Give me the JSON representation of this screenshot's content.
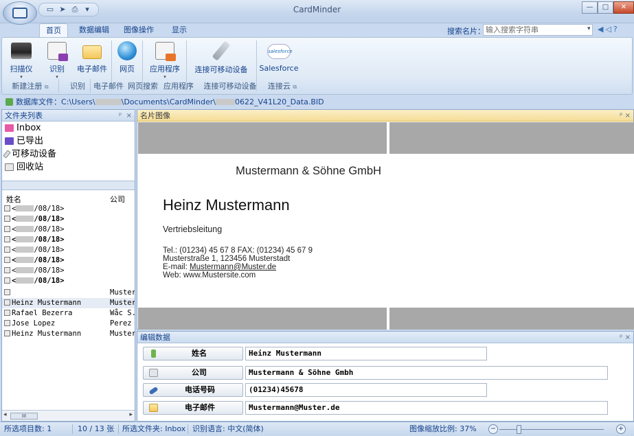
{
  "window": {
    "title": "CardMinder"
  },
  "quick_access": {
    "icons": [
      "scanner-icon",
      "pointer-icon",
      "print-icon",
      "dropdown-icon"
    ]
  },
  "tabs": [
    {
      "label": "首页",
      "active": true
    },
    {
      "label": "数据编辑",
      "active": false
    },
    {
      "label": "图像操作",
      "active": false
    },
    {
      "label": "显示",
      "active": false
    }
  ],
  "search": {
    "label": "搜索名片：",
    "placeholder": "输入搜索字符串"
  },
  "ribbon": {
    "buttons": [
      {
        "label": "扫描仪",
        "icon": "scanner-icon",
        "has_dropdown": true
      },
      {
        "label": "识别",
        "icon": "recognize-icon",
        "has_dropdown": true
      },
      {
        "label": "电子邮件",
        "icon": "email-icon",
        "has_dropdown": false
      },
      {
        "label": "网页",
        "icon": "web-icon",
        "has_dropdown": false
      },
      {
        "label": "应用程序",
        "icon": "app-icon",
        "has_dropdown": true
      },
      {
        "label": "连接可移动设备",
        "icon": "mobile-device-icon",
        "has_dropdown": false
      },
      {
        "label": "Salesforce",
        "icon": "salesforce-icon",
        "has_dropdown": false
      }
    ],
    "groups": [
      "新建注册",
      "识别",
      "电子邮件",
      "网页搜索",
      "应用程序",
      "连接可移动设备",
      "连接云"
    ],
    "salesforce_badge": "salesforce"
  },
  "db": {
    "label": "数据库文件：",
    "path_start": "C:\\Users\\",
    "path_mid": "\\Documents\\CardMinder\\",
    "path_end": "0622_V41L20_Data.BID"
  },
  "folder_pane": {
    "title": "文件夹列表",
    "pin": "ᵖ",
    "close": "×",
    "folders": [
      {
        "label": "Inbox",
        "icon": "inbox-icon"
      },
      {
        "label": "已导出",
        "icon": "exported-icon"
      },
      {
        "label": "可移动设备",
        "icon": "mobile-device-icon"
      },
      {
        "label": "回收站",
        "icon": "recycle-bin-icon"
      }
    ]
  },
  "card_list": {
    "headers": {
      "name": "姓名",
      "company": "公司"
    },
    "rows": [
      {
        "name": "<",
        "date": "/08/18>",
        "company": "",
        "bold": false
      },
      {
        "name": "<",
        "date": "/08/18>",
        "company": "",
        "bold": true
      },
      {
        "name": "<",
        "date": "/08/18>",
        "company": "",
        "bold": false
      },
      {
        "name": "<",
        "date": "/08/18>",
        "company": "",
        "bold": true
      },
      {
        "name": "<",
        "date": "/08/18>",
        "company": "",
        "bold": false
      },
      {
        "name": "<",
        "date": "/08/18>",
        "company": "",
        "bold": true
      },
      {
        "name": "<",
        "date": "/08/18>",
        "company": "",
        "bold": false
      },
      {
        "name": "<",
        "date": "/08/18>",
        "company": "",
        "bold": true
      },
      {
        "name": "",
        "date": "",
        "company": "Muster",
        "bold": false
      },
      {
        "name": "Heinz Mustermann",
        "date": "",
        "company": "Muster",
        "bold": false
      },
      {
        "name": "Rafael Bezerra",
        "date": "",
        "company": "Wåc S.",
        "bold": false
      },
      {
        "name": "Jose Lopez",
        "date": "",
        "company": "Perez",
        "bold": false
      },
      {
        "name": "Heinz Mustermann",
        "date": "",
        "company": "Muster",
        "bold": false
      }
    ],
    "scroll_thumb": "III"
  },
  "card_pane": {
    "title": "名片图像",
    "card": {
      "company": "Mustermann & Söhne GmbH",
      "name": "Heinz Mustermann",
      "role": "Vertriebsleitung",
      "phone_line": "Tel.: (01234) 45 67 8 FAX: (01234) 45 67 9",
      "address_line": "Musterstraße 1, 123456 Musterstadt",
      "email_prefix": "E-mail: ",
      "email": "Mustermann@Muster.de",
      "web_line": "Web: www.Mustersite.com"
    }
  },
  "edit_pane": {
    "title": "编辑数据",
    "fields": [
      {
        "label": "姓名",
        "value": "Heinz Mustermann",
        "icon": "person-icon"
      },
      {
        "label": "公司",
        "value": "Mustermann & Söhne Gmbh",
        "icon": "company-icon"
      },
      {
        "label": "电话号码",
        "value": "(01234)45678",
        "icon": "phone-icon"
      },
      {
        "label": "电子邮件",
        "value": "Mustermann@Muster.de",
        "icon": "email-icon"
      }
    ]
  },
  "status": {
    "selected_count": "所选项目数:  1",
    "sheet_count": "10 / 13 张",
    "folder": "所选文件夹: Inbox",
    "language": "识别语言: 中文(简体)",
    "zoom": "图像缩放比例: 37%",
    "zoom_minus": "−",
    "zoom_plus": "+"
  },
  "colors": {
    "accent": "#15428b",
    "card_header": "#f5dd97",
    "ribbon_bg": "#dfeaf6"
  }
}
